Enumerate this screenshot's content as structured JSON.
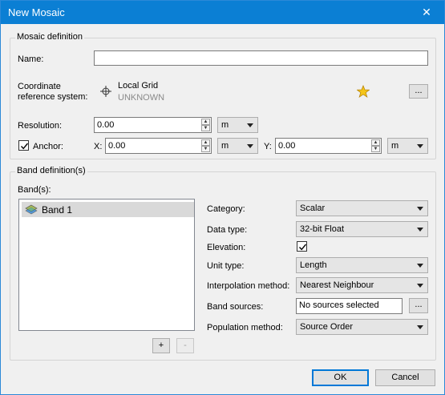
{
  "window": {
    "title": "New Mosaic",
    "close_glyph": "✕"
  },
  "mosaic": {
    "legend": "Mosaic definition",
    "name_label": "Name:",
    "name_value": "",
    "crs_label_line1": "Coordinate",
    "crs_label_line2": "reference system:",
    "crs_name": "Local Grid",
    "crs_sub": "UNKNOWN",
    "crs_icon": "crosshair-icon",
    "favorite_icon": "star-icon",
    "browse_label": "...",
    "resolution_label": "Resolution:",
    "resolution_value": "0.00",
    "resolution_unit": "m",
    "anchor_label": "Anchor:",
    "anchor_checked": true,
    "x_label": "X:",
    "x_value": "0.00",
    "x_unit": "m",
    "y_label": "Y:",
    "y_value": "0.00",
    "y_unit": "m"
  },
  "band": {
    "legend": "Band definition(s)",
    "bands_label": "Band(s):",
    "items": [
      {
        "label": "Band 1",
        "icon": "raster-layer-icon"
      }
    ],
    "add_label": "+",
    "remove_label": "-",
    "category_label": "Category:",
    "category_value": "Scalar",
    "datatype_label": "Data type:",
    "datatype_value": "32-bit Float",
    "elevation_label": "Elevation:",
    "elevation_checked": true,
    "unittype_label": "Unit type:",
    "unittype_value": "Length",
    "interp_label": "Interpolation method:",
    "interp_value": "Nearest Neighbour",
    "sources_label": "Band sources:",
    "sources_value": "No sources selected",
    "sources_browse": "...",
    "population_label": "Population method:",
    "population_value": "Source Order"
  },
  "footer": {
    "ok_label": "OK",
    "cancel_label": "Cancel"
  },
  "colors": {
    "titlebar": "#0b7fd4",
    "accent": "#0078d7",
    "star": "#f5c518"
  }
}
